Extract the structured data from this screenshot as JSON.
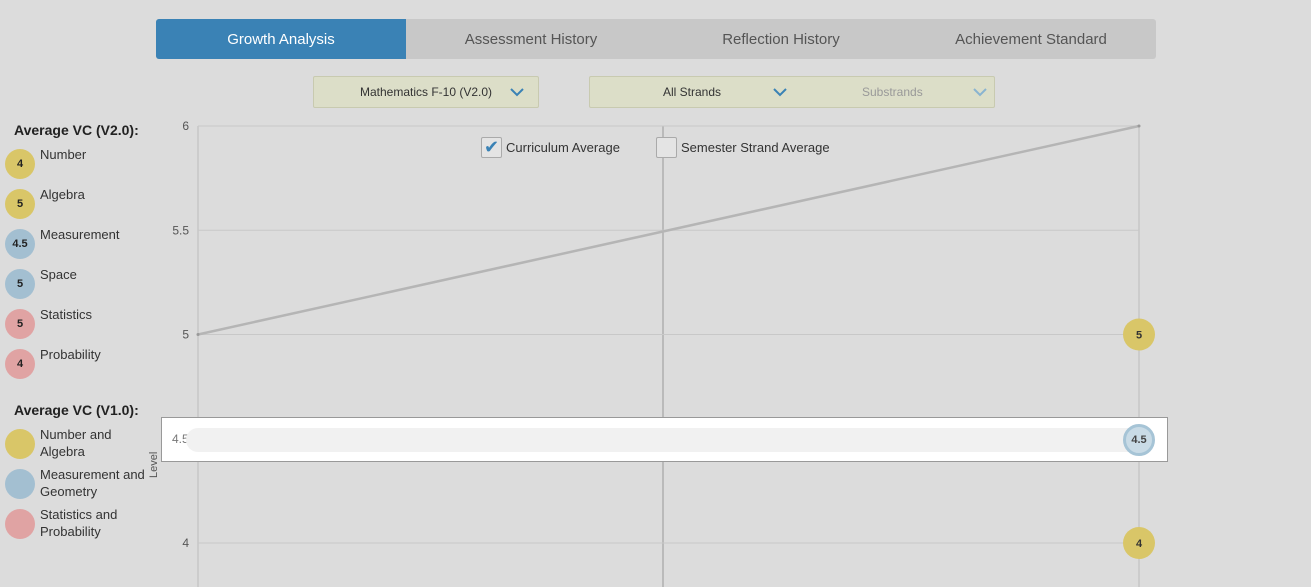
{
  "tabs": [
    {
      "label": "Growth Analysis",
      "active": true
    },
    {
      "label": "Assessment History",
      "active": false
    },
    {
      "label": "Reflection History",
      "active": false
    },
    {
      "label": "Achievement Standard",
      "active": false
    }
  ],
  "filters": {
    "curriculum": "Mathematics F-10 (V2.0)",
    "strand": "All Strands",
    "substrand_placeholder": "Substrands"
  },
  "legend_v2": {
    "title": "Average VC (V2.0):",
    "items": [
      {
        "value": "4",
        "label": "Number",
        "color": "#d9c668"
      },
      {
        "value": "5",
        "label": "Algebra",
        "color": "#d9c668"
      },
      {
        "value": "4.5",
        "label": "Measurement",
        "color": "#a3bfd1"
      },
      {
        "value": "5",
        "label": "Space",
        "color": "#a3bfd1"
      },
      {
        "value": "5",
        "label": "Statistics",
        "color": "#e0a3a3"
      },
      {
        "value": "4",
        "label": "Probability",
        "color": "#e0a3a3"
      }
    ]
  },
  "legend_v1": {
    "title": "Average VC (V1.0):",
    "items": [
      {
        "value": "",
        "label": "Number and Algebra",
        "color": "#d9c668"
      },
      {
        "value": "",
        "label": "Measurement and Geometry",
        "color": "#a3bfd1"
      },
      {
        "value": "",
        "label": "Statistics and Probability",
        "color": "#e0a3a3"
      }
    ]
  },
  "checkboxes": {
    "curriculum_average": {
      "label": "Curriculum Average",
      "checked": true
    },
    "semester_strand_average": {
      "label": "Semester Strand Average",
      "checked": false
    }
  },
  "chart_data": {
    "type": "line",
    "ylabel": "Level",
    "y_ticks": [
      "6",
      "5.5",
      "5",
      "4.5",
      "4"
    ],
    "ylim": [
      3.8,
      6
    ],
    "grid": true,
    "series": [
      {
        "points": [
          {
            "x": 0,
            "y": 5
          },
          {
            "x": 1,
            "y": 6
          }
        ],
        "color": "#b5b5b5"
      }
    ],
    "markers": [
      {
        "x": 1,
        "y": 5,
        "label": "5",
        "color": "#d9c668"
      },
      {
        "x": 1,
        "y": 4,
        "label": "4",
        "color": "#d9c668"
      }
    ],
    "hover": {
      "y": 4.5,
      "tick_label": "4.5",
      "label": "4.5"
    }
  }
}
